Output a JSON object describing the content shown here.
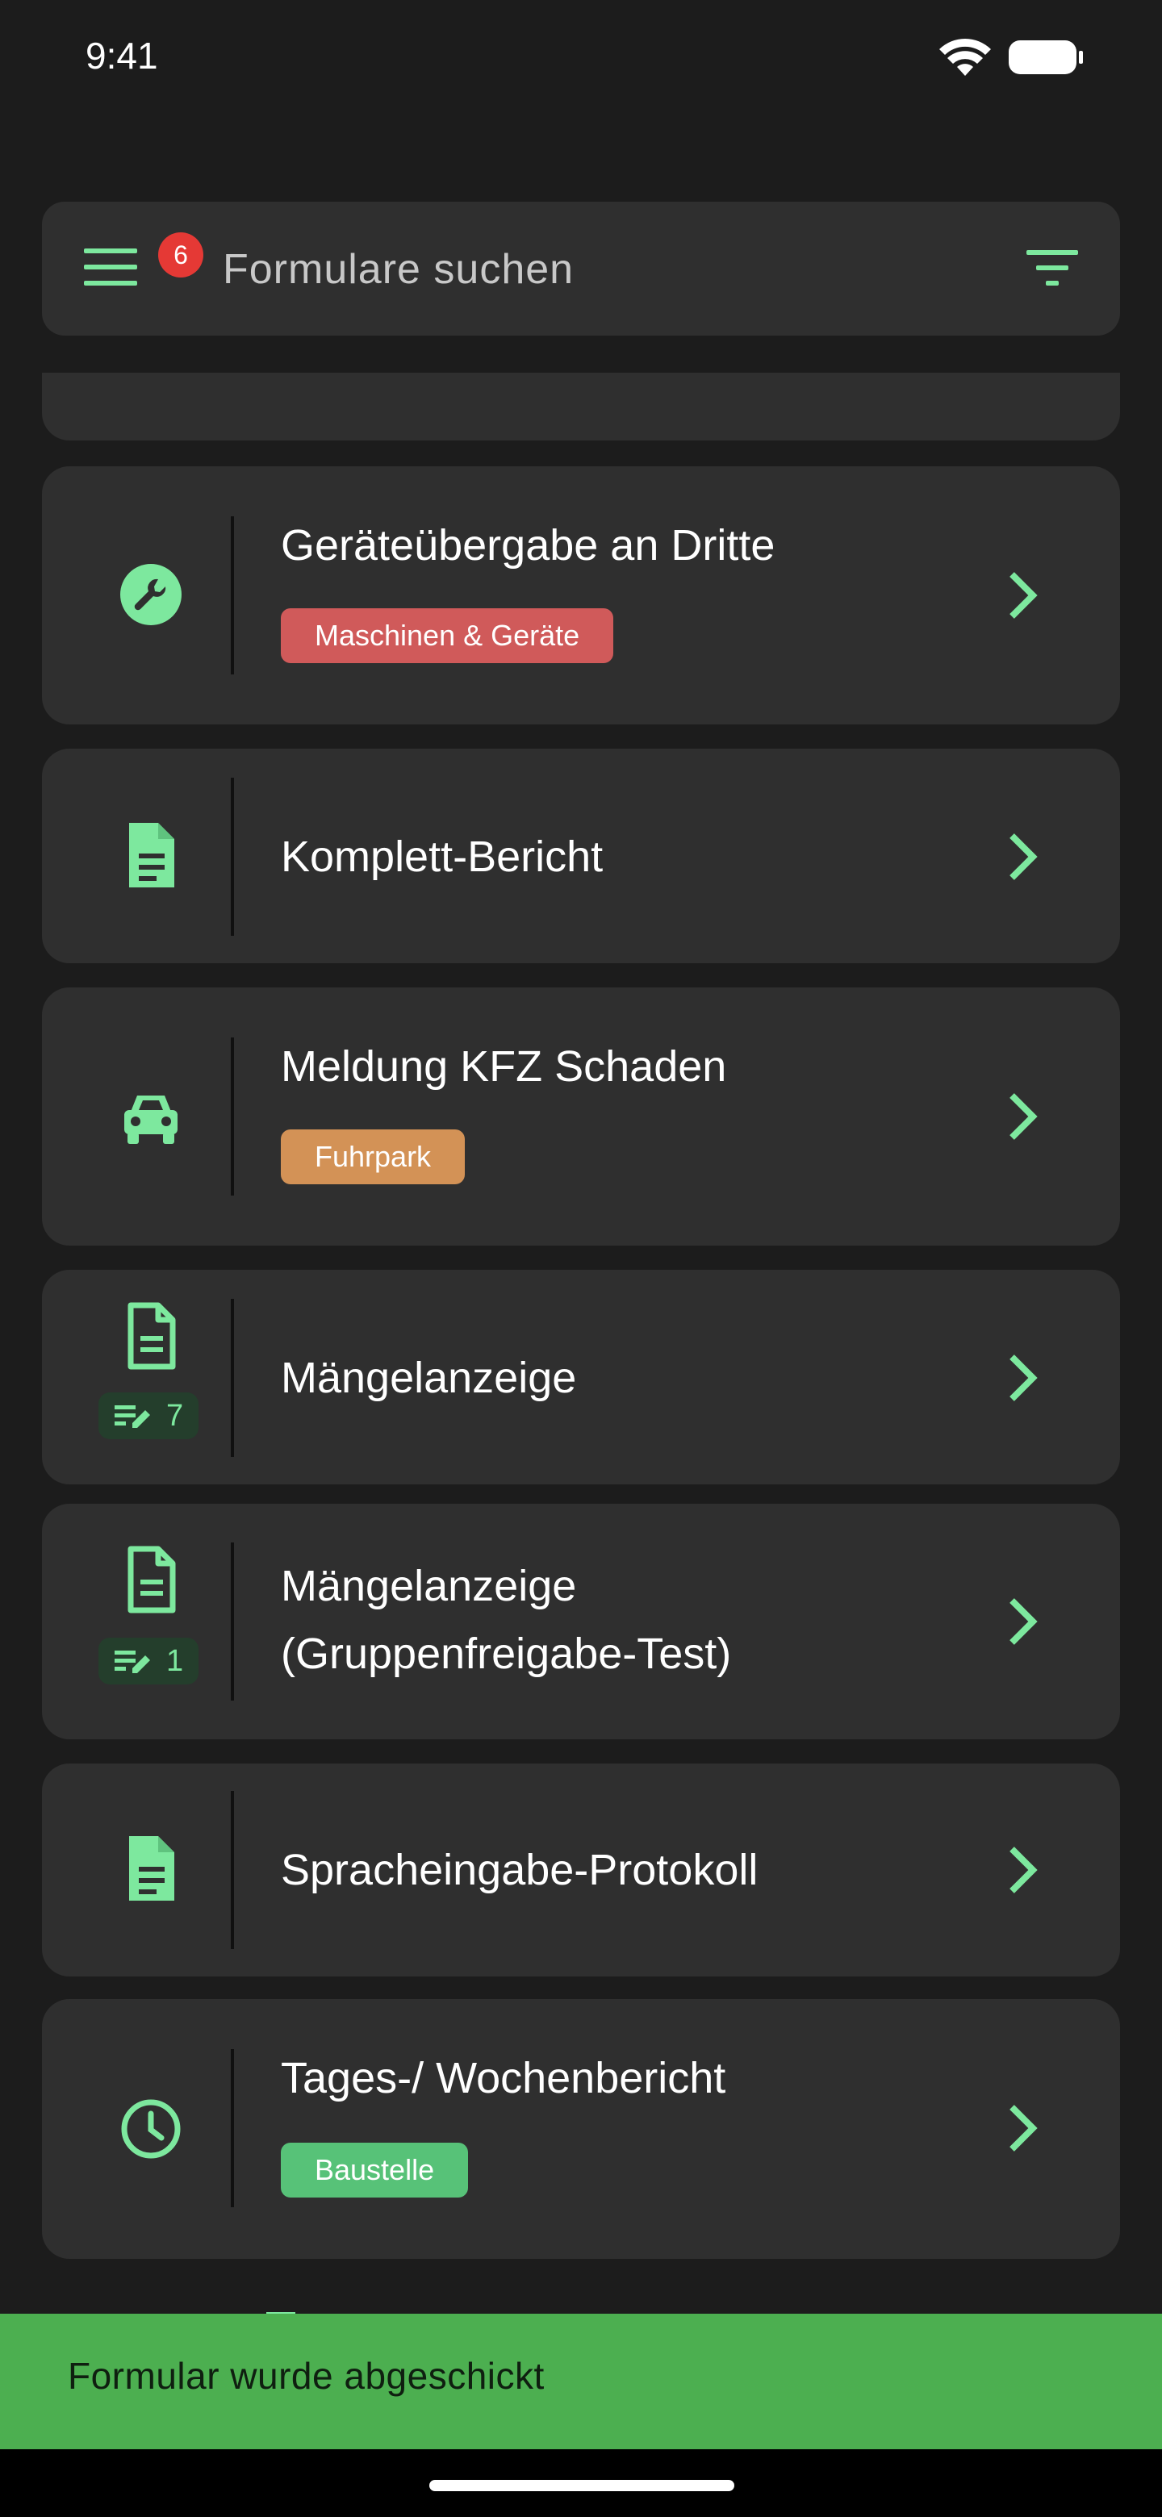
{
  "status_bar": {
    "time": "9:41"
  },
  "search": {
    "placeholder": "Formulare suchen",
    "menu_badge_count": "6"
  },
  "colors": {
    "accent": "#7de89e",
    "card_bg": "#2f2f2f",
    "tag_machines": "#d05a5a",
    "tag_fleet": "#d39256",
    "tag_site": "#57c278",
    "snackbar": "#4caf50",
    "badge": "#e53935"
  },
  "forms": [
    {
      "title": "Geräteübergabe an Dritte",
      "tag": "Maschinen & Geräte",
      "icon": "wrench-icon"
    },
    {
      "title": "Komplett-Bericht",
      "icon": "document-icon"
    },
    {
      "title": "Meldung KFZ Schaden",
      "tag": "Fuhrpark",
      "icon": "car-icon"
    },
    {
      "title": "Mängelanzeige",
      "icon": "document-icon",
      "draft_count": "7"
    },
    {
      "title_line1": "Mängelanzeige",
      "title_line2": "(Gruppenfreigabe-Test)",
      "icon": "document-icon",
      "draft_count": "1"
    },
    {
      "title": "Spracheingabe-Protokoll",
      "icon": "document-icon"
    },
    {
      "title": "Tages-/ Wochenbericht",
      "tag": "Baustelle",
      "icon": "clock-icon"
    }
  ],
  "snackbar": {
    "message": "Formular wurde abgeschickt"
  }
}
